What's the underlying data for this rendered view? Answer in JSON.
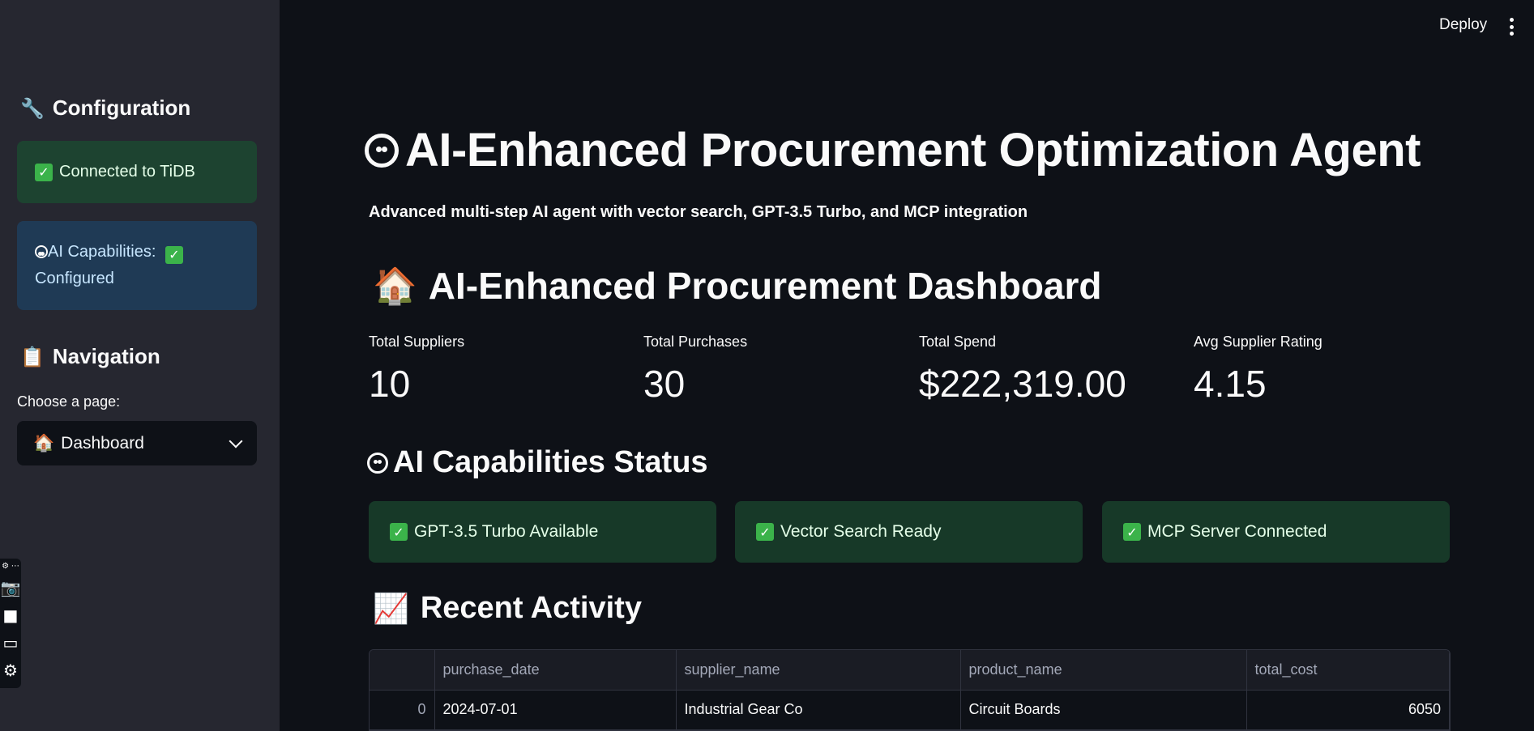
{
  "header": {
    "deploy_label": "Deploy"
  },
  "sidebar": {
    "config_heading": "Configuration",
    "config_icon": "🔧",
    "connection_status": "Connected to TiDB",
    "ai_caps_line1": "AI Capabilities:",
    "ai_caps_line2": "Configured",
    "nav_heading": "Navigation",
    "nav_icon": "📋",
    "choose_label": "Choose a page:",
    "selected_page": "Dashboard",
    "selected_icon": "🏠"
  },
  "main": {
    "title": "AI-Enhanced Procurement Optimization Agent",
    "subtitle": "Advanced multi-step AI agent with vector search, GPT-3.5 Turbo, and MCP integration",
    "dashboard_heading": "AI-Enhanced Procurement Dashboard",
    "dashboard_icon": "🏠",
    "metrics": [
      {
        "label": "Total Suppliers",
        "value": "10"
      },
      {
        "label": "Total Purchases",
        "value": "30"
      },
      {
        "label": "Total Spend",
        "value": "$222,319.00"
      },
      {
        "label": "Avg Supplier Rating",
        "value": "4.15"
      }
    ],
    "status_heading": "AI Capabilities Status",
    "status_items": [
      "GPT-3.5 Turbo Available",
      "Vector Search Ready",
      "MCP Server Connected"
    ],
    "activity_heading": "Recent Activity",
    "activity_icon": "📈",
    "table": {
      "columns": [
        "purchase_date",
        "supplier_name",
        "product_name",
        "total_cost"
      ],
      "rows": [
        {
          "index": "0",
          "purchase_date": "2024-07-01",
          "supplier_name": "Industrial Gear Co",
          "product_name": "Circuit Boards",
          "total_cost": "6050"
        }
      ]
    }
  },
  "colors": {
    "background": "#0e1117",
    "sidebar": "#262730",
    "success": "#173928",
    "info": "#1f3a55"
  }
}
